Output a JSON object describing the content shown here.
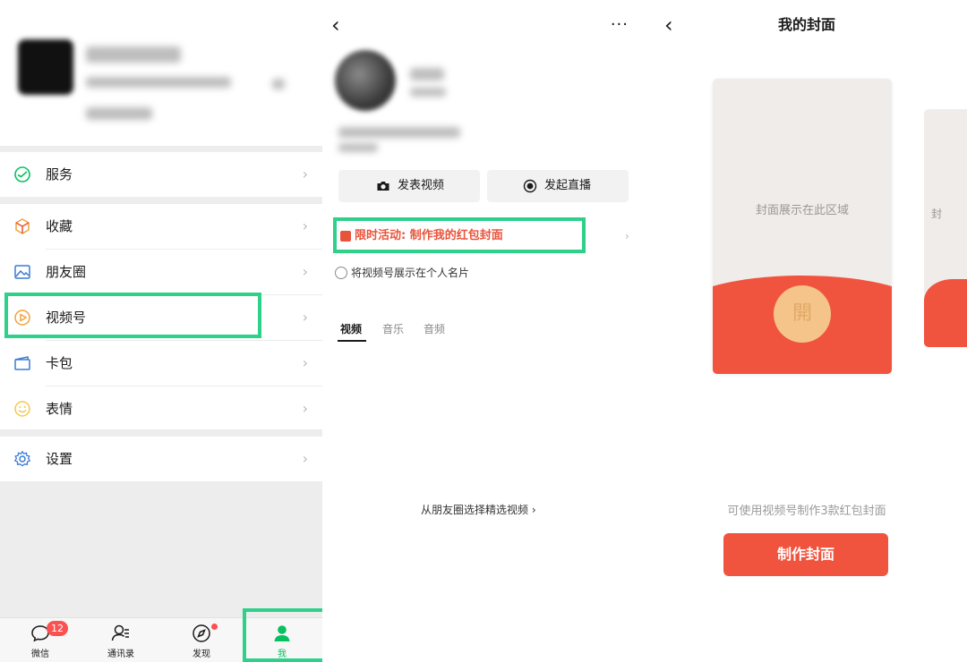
{
  "me_page": {
    "menu": {
      "services_label": "服务",
      "favorites_label": "收藏",
      "moments_label": "朋友圈",
      "channels_label": "视频号",
      "cards_label": "卡包",
      "stickers_label": "表情",
      "settings_label": "设置"
    },
    "tabbar": {
      "chats_label": "微信",
      "chats_badge": "12",
      "contacts_label": "通讯录",
      "discover_label": "发现",
      "me_label": "我"
    }
  },
  "channels_page": {
    "more_label": "···",
    "post_video_label": "发表视频",
    "start_live_label": "发起直播",
    "promo_label": "限时活动: 制作我的红包封面",
    "show_on_card_label": "将视频号展示在个人名片",
    "tabs": {
      "video": "视频",
      "music": "音乐",
      "audio": "音频"
    },
    "select_from_moments": "从朋友圈选择精选视频 ›"
  },
  "cover_page": {
    "title": "我的封面",
    "envelope_placeholder": "封面展示在此区域",
    "seal_char": "開",
    "next_envelope_text": "封",
    "hint": "可使用视频号制作3款红包封面",
    "make_button": "制作封面"
  },
  "colors": {
    "highlight": "#2ed08a",
    "accent_red": "#f0543f",
    "badge_red": "#fa5151",
    "wechat_green": "#07c160"
  }
}
